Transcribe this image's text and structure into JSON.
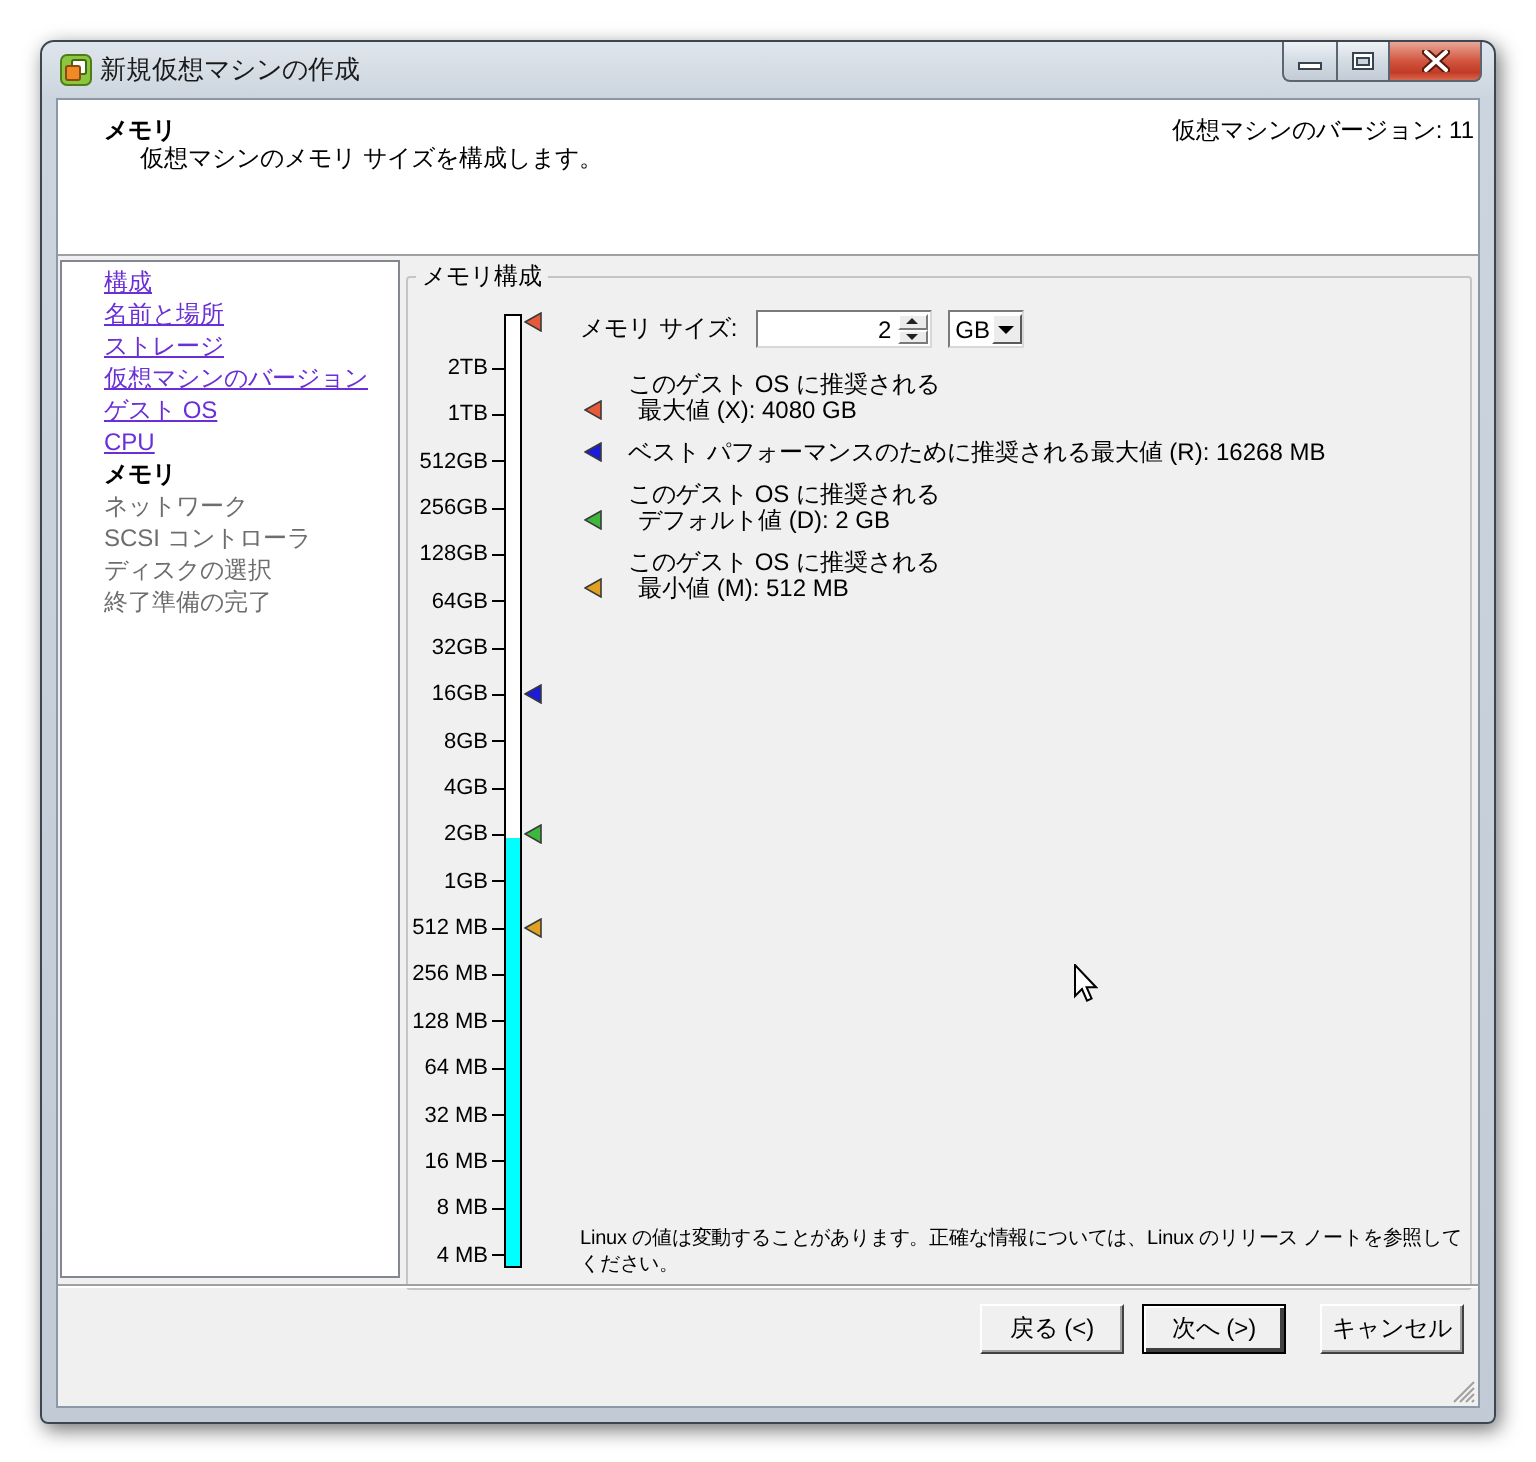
{
  "window": {
    "title": "新規仮想マシンの作成"
  },
  "header": {
    "title": "メモリ",
    "subtitle": "仮想マシンのメモリ サイズを構成します。",
    "version": "仮想マシンのバージョン: 11"
  },
  "steps": [
    {
      "label": "構成",
      "completed": true,
      "selected": false
    },
    {
      "label": "名前と場所",
      "completed": true,
      "selected": false
    },
    {
      "label": "ストレージ",
      "completed": true,
      "selected": false
    },
    {
      "label": "仮想マシンのバージョン",
      "completed": true,
      "selected": false
    },
    {
      "label": "ゲスト OS",
      "completed": true,
      "selected": false
    },
    {
      "label": "CPU",
      "completed": true,
      "selected": false
    },
    {
      "label": "メモリ",
      "completed": false,
      "selected": true
    },
    {
      "label": "ネットワーク",
      "completed": false,
      "selected": false
    },
    {
      "label": "SCSI コントローラ",
      "completed": false,
      "selected": false
    },
    {
      "label": "ディスクの選択",
      "completed": false,
      "selected": false
    },
    {
      "label": "終了準備の完了",
      "completed": false,
      "selected": false
    }
  ],
  "memory_group": {
    "title": "メモリ構成",
    "scale": {
      "level": 0.45,
      "stops": [
        {
          "color": "#e8583a"
        },
        {
          "label": "2TB"
        },
        {
          "label": "1TB"
        },
        {
          "label": "512GB"
        },
        {
          "label": "256GB"
        },
        {
          "label": "128GB"
        },
        {
          "label": "64GB"
        },
        {
          "label": "32GB"
        },
        {
          "label": "16GB",
          "color": "#1c1cd8"
        },
        {
          "label": "8GB"
        },
        {
          "label": "4GB"
        },
        {
          "label": "2GB",
          "color": "#3cb83c"
        },
        {
          "label": "1GB"
        },
        {
          "label": "512 MB",
          "color": "#e0a020"
        },
        {
          "label": "256 MB"
        },
        {
          "label": "128 MB"
        },
        {
          "label": "64 MB"
        },
        {
          "label": "32 MB"
        },
        {
          "label": "16 MB"
        },
        {
          "label": "8 MB"
        },
        {
          "label": "4 MB"
        }
      ]
    },
    "size": {
      "label": "メモリ サイズ:",
      "value": "2",
      "unit": "GB"
    },
    "recommendations": [
      {
        "color": "#e8583a",
        "lines": [
          "このゲスト OS に推奨される",
          "最大値 (X): 4080 GB"
        ]
      },
      {
        "color": "#1c1cd8",
        "lines": [
          "ベスト パフォーマンスのために推奨される最大値 (R): 16268 MB"
        ]
      },
      {
        "color": "#3cb83c",
        "lines": [
          "このゲスト OS に推奨される",
          "デフォルト値 (D): 2 GB"
        ]
      },
      {
        "color": "#e0a020",
        "lines": [
          "このゲスト OS に推奨される",
          "最小値 (M): 512 MB"
        ]
      }
    ],
    "note": "Linux の値は変動することがあります。正確な情報については、Linux のリリース ノートを参照してください。"
  },
  "buttons": [
    {
      "label": "戻る (<)",
      "default": false
    },
    {
      "label": "次へ (>)",
      "default": true
    },
    {
      "label": "キャンセル",
      "default": false
    }
  ]
}
